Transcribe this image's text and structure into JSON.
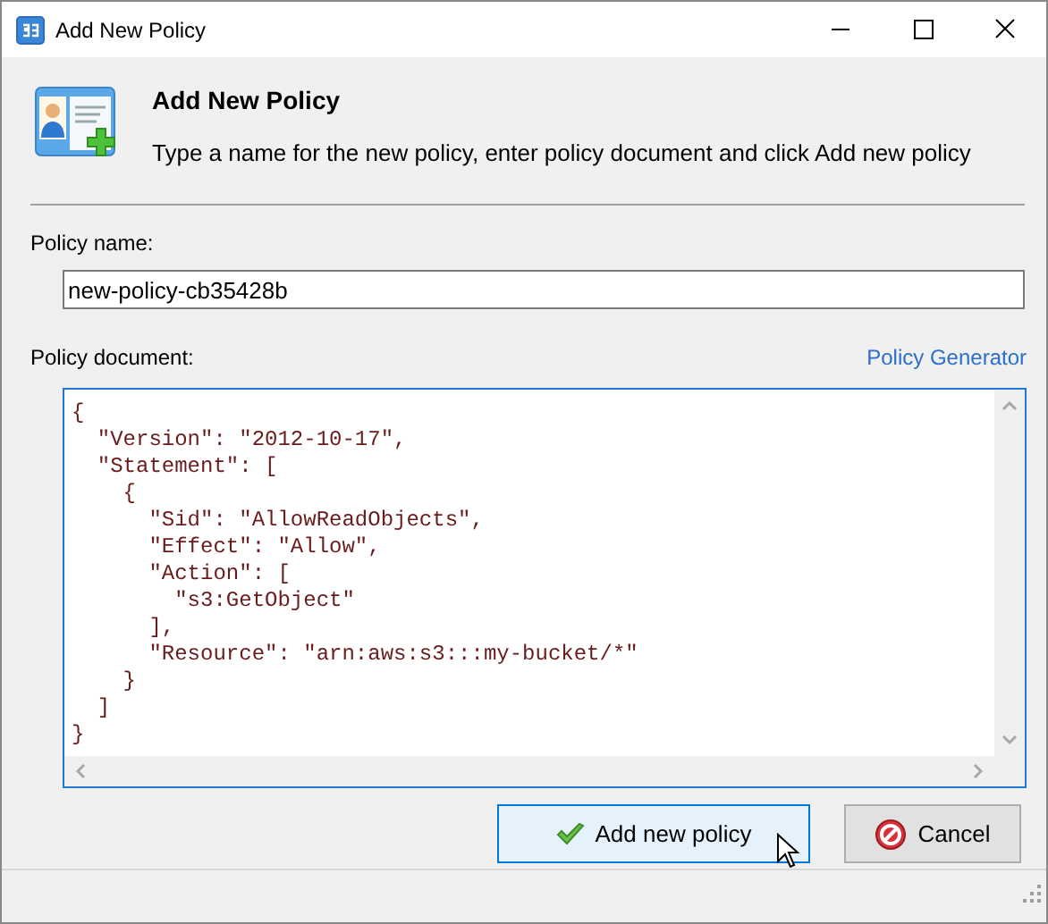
{
  "window": {
    "title": "Add New Policy"
  },
  "header": {
    "title": "Add New Policy",
    "description": "Type a name for the new policy, enter policy document and click Add new policy"
  },
  "policy_name": {
    "label": "Policy name:",
    "value": "new-policy-cb35428b"
  },
  "policy_document": {
    "label": "Policy document:",
    "link": "Policy Generator",
    "lines": [
      "{",
      "  \"Version\": \"2012-10-17\",",
      "  \"Statement\": [",
      "    {",
      "      \"Sid\": \"AllowReadObjects\",",
      "      \"Effect\": \"Allow\",",
      "      \"Action\": [",
      "        \"s3:GetObject\"",
      "      ],",
      "      \"Resource\": \"arn:aws:s3:::my-bucket/*\"",
      "    }",
      "  ]",
      "}"
    ]
  },
  "buttons": [
    {
      "kind": "ok",
      "label": "Add new policy",
      "selected": true
    },
    {
      "kind": "cancel",
      "label": "Cancel",
      "selected": false
    }
  ]
}
